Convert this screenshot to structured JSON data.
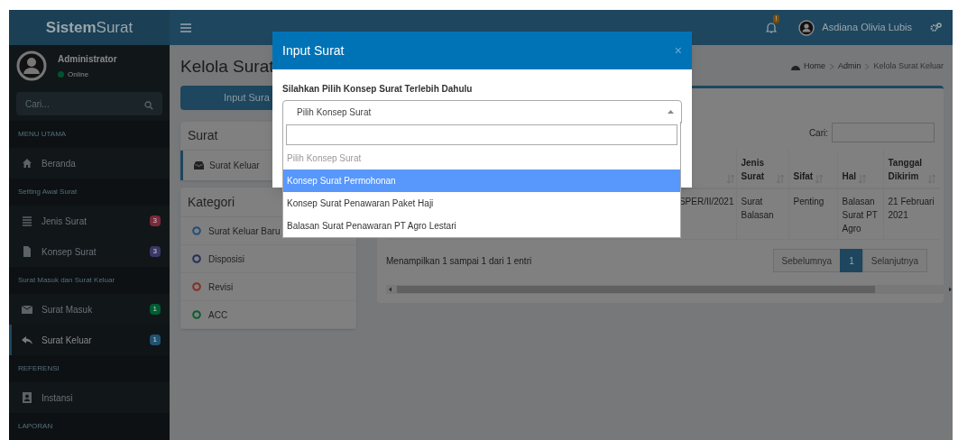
{
  "navbar": {
    "brand_bold": "Sistem",
    "brand_light": "Surat",
    "notification_badge": "!",
    "user_name": "Asdiana Olivia Lubis"
  },
  "sidebar": {
    "user": {
      "name": "Administrator",
      "status": "Online"
    },
    "search": {
      "placeholder": "Cari..."
    },
    "items": [
      {
        "kind": "header",
        "label": "MENU UTAMA"
      },
      {
        "kind": "link",
        "label": "Beranda",
        "selected": false
      },
      {
        "kind": "header",
        "label": "Setting Awal Surat"
      },
      {
        "kind": "link",
        "label": "Jenis Surat",
        "selected": false,
        "badge": "3",
        "color": "#7a2a3a"
      },
      {
        "kind": "link",
        "label": "Konsep Surat",
        "selected": false,
        "badge": "3",
        "color": "#3a3766"
      },
      {
        "kind": "header",
        "label": "Surat Masuk dan Surat Keluar"
      },
      {
        "kind": "link",
        "label": "Surat Masuk",
        "selected": false,
        "badge": "1",
        "color": "#005c32"
      },
      {
        "kind": "link",
        "label": "Surat Keluar",
        "selected": true,
        "badge": "1",
        "color": "#215170"
      },
      {
        "kind": "header",
        "label": "REFERENSI"
      },
      {
        "kind": "link",
        "label": "Instansi",
        "selected": false
      },
      {
        "kind": "header",
        "label": "LAPORAN"
      }
    ]
  },
  "page": {
    "title": "Kelola Surat",
    "breadcrumb": [
      "Home",
      "Admin",
      "Kelola Surat Keluar"
    ]
  },
  "input_button": "Input Sura",
  "surat_box": {
    "title": "Surat",
    "items": [
      {
        "label": "Surat Keluar",
        "selected": true
      }
    ]
  },
  "kategori_box": {
    "title": "Kategori",
    "items": [
      {
        "label": "Surat Keluar Baru",
        "color": "#1f4f7a"
      },
      {
        "label": "Disposisi",
        "color": "#242d5c"
      },
      {
        "label": "Revisi",
        "color": "#8a2a22"
      },
      {
        "label": "ACC",
        "color": "#0a5c32"
      }
    ]
  },
  "table_box": {
    "search_label": "Cari:",
    "table": {
      "columns": [
        "",
        "Jenis Surat",
        "Sifat",
        "Hal",
        "Tanggal Dikirim"
      ],
      "rows": [
        [
          "SPER/II/2021",
          "Surat Balasan",
          "Penting",
          "Balasan Surat PT Agro",
          "21 Februari 2021"
        ]
      ]
    },
    "info": "Menampilkan 1 sampai 1 dari 1 entri",
    "pagination": [
      {
        "label": "Sebelumnya",
        "selected": false
      },
      {
        "label": "1",
        "selected": true
      },
      {
        "label": "Selanjutnya",
        "selected": false
      }
    ]
  },
  "modal": {
    "title": "Input Surat",
    "close": "×",
    "label": "Silahkan Pilih Konsep Surat Terlebih Dahulu",
    "select": {
      "value": "Pilih Konsep Surat",
      "expanded": true,
      "options": [
        {
          "label": "Pilih Konsep Surat",
          "disabled": true,
          "highlighted": false
        },
        {
          "label": "Konsep Surat Permohonan",
          "disabled": false,
          "highlighted": true
        },
        {
          "label": "Konsep Surat Penawaran Paket Haji",
          "disabled": false,
          "highlighted": false
        },
        {
          "label": "Balasan Surat Penawaran PT Agro Lestari",
          "disabled": false,
          "highlighted": false
        }
      ]
    }
  }
}
